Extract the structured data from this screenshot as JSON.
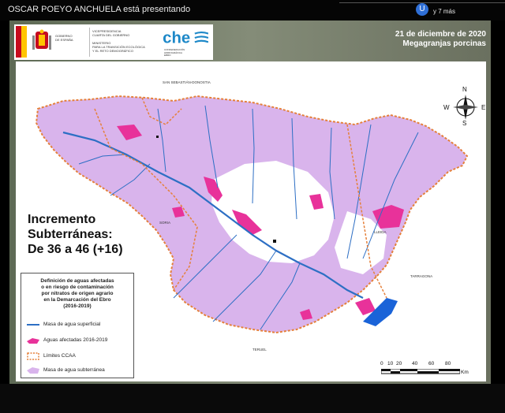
{
  "meeting": {
    "presenter_text": "OSCAR POEYO ANCHUELA está presentando",
    "participant_avatar": "U",
    "more_participants": "y 7 más"
  },
  "slide": {
    "date": "21 de diciembre de 2020",
    "subtitle": "Megagranjas porcinas",
    "government": {
      "line1": "GOBIERNO",
      "line2": "DE ESPAÑA",
      "vice1": "VICEPRESIDENCIA",
      "vice2": "CUARTA DEL GOBIERNO",
      "min1": "MINISTERIO",
      "min2": "PARA LA TRANSICIÓN ECOLÓGICA",
      "min3": "Y EL RETO DEMOGRÁFICO"
    },
    "che": {
      "name": "che",
      "caption1": "CONFEDERACIÓN",
      "caption2": "HIDROGRÁFICA",
      "caption3": "EBRO"
    },
    "highlight_text": "Incremento\nSubterráneas:\nDe 36 a 46 (+16)",
    "cities": {
      "san_sebastian": "SAN SEBASTIÁN-DONOSTIA",
      "soria": "SORIA",
      "lleida": "LLEIDA",
      "tarragona": "TARRAGONA",
      "teruel": "TERUEL"
    },
    "compass": {
      "n": "N",
      "s": "S",
      "e": "E",
      "w": "W"
    },
    "legend": {
      "title": "Definición de aguas afectadas\no en riesgo de contaminación\npor nitratos de origen agrario\nen la Demarcación del Ebro\n(2016-2019)",
      "items": [
        {
          "label": "Masa de agua superficial",
          "symbol": "river-line-icon"
        },
        {
          "label": "Aguas afectadas 2016-2019",
          "symbol": "affected-area-icon"
        },
        {
          "label": "Límites CCAA",
          "symbol": "boundary-line-icon"
        },
        {
          "label": "Masa de agua subterránea",
          "symbol": "groundwater-area-icon"
        }
      ]
    },
    "scale": {
      "ticks": [
        "0",
        "10",
        "20",
        "40",
        "60",
        "80"
      ],
      "unit": "Km"
    },
    "colors": {
      "groundwater": "#d9b4ec",
      "affected": "#e8329a",
      "river": "#2d6fc4",
      "ccaa_boundary": "#e5803a",
      "catalan_zone": "#1a63d8"
    }
  }
}
